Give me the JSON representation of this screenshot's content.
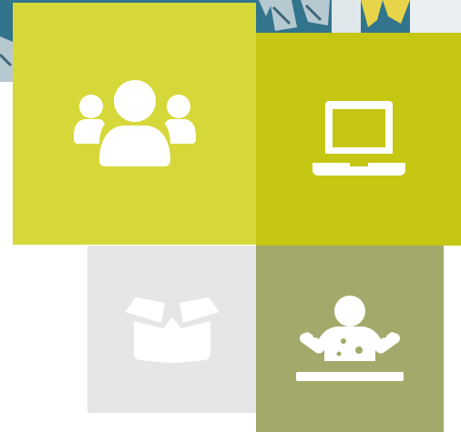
{
  "colors": {
    "team_tile": "#d6d83a",
    "laptop_tile": "#c5c713",
    "box_tile": "#e6e6e6",
    "stage_tile": "#a3a96a",
    "photo_background": "#2f6f86",
    "icon_fill": "#ffffff"
  },
  "tiles": [
    {
      "icon": "users-group-icon"
    },
    {
      "icon": "laptop-icon"
    },
    {
      "icon": "open-box-icon"
    },
    {
      "icon": "presenter-podium-icon"
    }
  ]
}
